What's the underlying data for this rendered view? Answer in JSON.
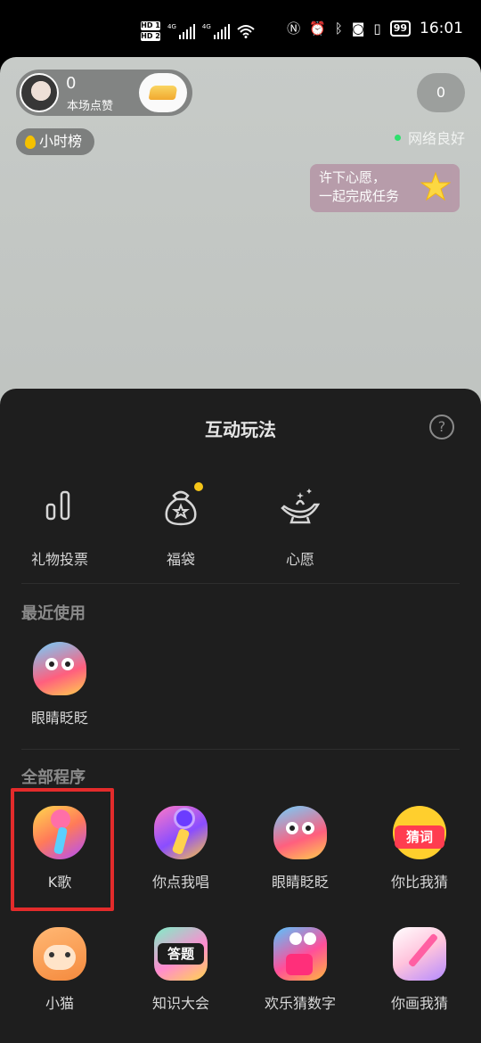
{
  "status_bar": {
    "hd1": "HD 1",
    "hd2": "HD 2",
    "sig1": "4G",
    "sig2": "4G",
    "battery": "99",
    "time": "16:01"
  },
  "live": {
    "host_likes": "0",
    "host_likes_label": "本场点赞",
    "viewer_count": "0",
    "rank_label": "小时榜",
    "network_status": "网络良好",
    "wish_text_line1": "许下心愿，",
    "wish_text_line2": "一起完成任务"
  },
  "sheet": {
    "title": "互动玩法",
    "help_glyph": "?",
    "tools": [
      {
        "label": "礼物投票",
        "icon": "bar-chart-icon"
      },
      {
        "label": "福袋",
        "icon": "lucky-bag-icon",
        "badge": true
      },
      {
        "label": "心愿",
        "icon": "magic-lamp-icon"
      }
    ],
    "recent_section": "最近使用",
    "recent_apps": [
      {
        "label": "眼睛眨眨",
        "icon": "blink-eyes-icon"
      }
    ],
    "all_section": "全部程序",
    "all_apps": [
      {
        "label": "K歌",
        "icon": "microphone-icon"
      },
      {
        "label": "你点我唱",
        "icon": "mic-galaxy-icon"
      },
      {
        "label": "眼睛眨眨",
        "icon": "blink-eyes-icon"
      },
      {
        "label": "你比我猜",
        "icon": "guess-word-icon",
        "sign": "猜词"
      },
      {
        "label": "小猫",
        "icon": "cat-icon"
      },
      {
        "label": "知识大会",
        "icon": "quiz-icon",
        "sign": "答题"
      },
      {
        "label": "欢乐猜数字",
        "icon": "guess-number-icon"
      },
      {
        "label": "你画我猜",
        "icon": "draw-guess-icon"
      }
    ]
  },
  "colors": {
    "sheet_bg": "#1e1e1e",
    "highlight": "#e32b2b",
    "network_dot": "#2ee06d"
  }
}
